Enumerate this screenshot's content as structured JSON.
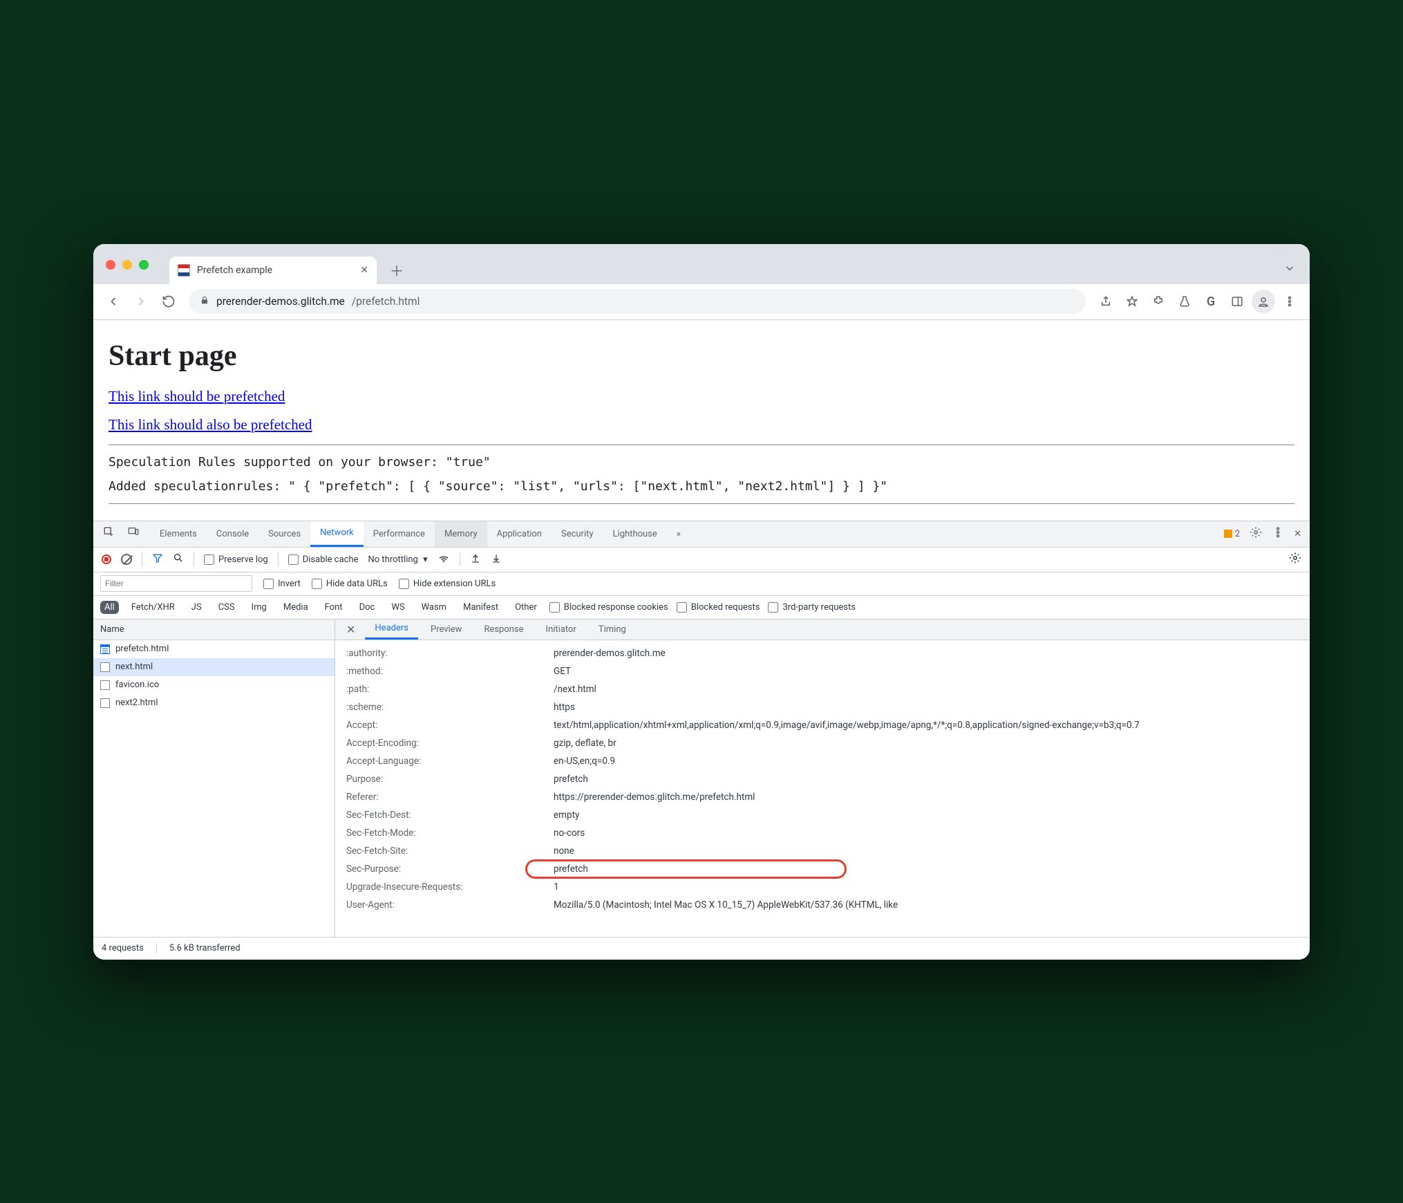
{
  "browser": {
    "tab_title": "Prefetch example",
    "url_host": "prerender-demos.glitch.me",
    "url_path": "/prefetch.html"
  },
  "page": {
    "h1": "Start page",
    "link1": "This link should be prefetched",
    "link2": "This link should also be prefetched",
    "status1": "Speculation Rules supported on your browser: \"true\"",
    "status2": "Added speculationrules: \" { \"prefetch\": [ { \"source\": \"list\", \"urls\": [\"next.html\", \"next2.html\"] } ] }\""
  },
  "devtools": {
    "tabs": {
      "elements": "Elements",
      "console": "Console",
      "sources": "Sources",
      "network": "Network",
      "performance": "Performance",
      "memory": "Memory",
      "application": "Application",
      "security": "Security",
      "lighthouse": "Lighthouse"
    },
    "warn_count": "2",
    "toolbar": {
      "preserve_log": "Preserve log",
      "disable_cache": "Disable cache",
      "throttling": "No throttling"
    },
    "filter": {
      "placeholder": "Filter",
      "invert": "Invert",
      "hide_data": "Hide data URLs",
      "hide_ext": "Hide extension URLs"
    },
    "types": {
      "all": "All",
      "fetch": "Fetch/XHR",
      "js": "JS",
      "css": "CSS",
      "img": "Img",
      "media": "Media",
      "font": "Font",
      "doc": "Doc",
      "ws": "WS",
      "wasm": "Wasm",
      "manifest": "Manifest",
      "other": "Other",
      "blocked_cookies": "Blocked response cookies",
      "blocked_req": "Blocked requests",
      "third_party": "3rd-party requests"
    },
    "name_col": "Name",
    "requests": [
      {
        "name": "prefetch.html",
        "type": "doc"
      },
      {
        "name": "next.html",
        "type": "blank"
      },
      {
        "name": "favicon.ico",
        "type": "blank"
      },
      {
        "name": "next2.html",
        "type": "blank"
      }
    ],
    "detail_tabs": {
      "headers": "Headers",
      "preview": "Preview",
      "response": "Response",
      "initiator": "Initiator",
      "timing": "Timing"
    },
    "headers": [
      {
        "k": ":authority:",
        "v": "prerender-demos.glitch.me"
      },
      {
        "k": ":method:",
        "v": "GET"
      },
      {
        "k": ":path:",
        "v": "/next.html"
      },
      {
        "k": ":scheme:",
        "v": "https"
      },
      {
        "k": "Accept:",
        "v": "text/html,application/xhtml+xml,application/xml;q=0.9,image/avif,image/webp,image/apng,*/*;q=0.8,application/signed-exchange;v=b3;q=0.7"
      },
      {
        "k": "Accept-Encoding:",
        "v": "gzip, deflate, br"
      },
      {
        "k": "Accept-Language:",
        "v": "en-US,en;q=0.9"
      },
      {
        "k": "Purpose:",
        "v": "prefetch"
      },
      {
        "k": "Referer:",
        "v": "https://prerender-demos.glitch.me/prefetch.html"
      },
      {
        "k": "Sec-Fetch-Dest:",
        "v": "empty"
      },
      {
        "k": "Sec-Fetch-Mode:",
        "v": "no-cors"
      },
      {
        "k": "Sec-Fetch-Site:",
        "v": "none"
      },
      {
        "k": "Sec-Purpose:",
        "v": "prefetch",
        "framed": true
      },
      {
        "k": "Upgrade-Insecure-Requests:",
        "v": "1"
      },
      {
        "k": "User-Agent:",
        "v": "Mozilla/5.0 (Macintosh; Intel Mac OS X 10_15_7) AppleWebKit/537.36 (KHTML, like"
      }
    ],
    "status": {
      "requests": "4 requests",
      "transferred": "5.6 kB transferred"
    }
  }
}
